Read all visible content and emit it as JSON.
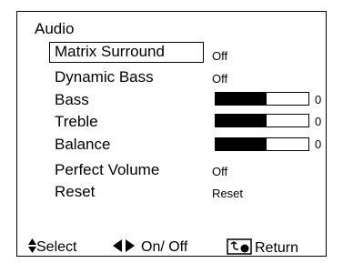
{
  "menu": {
    "title": "Audio",
    "items": [
      {
        "label": "Matrix Surround",
        "value": "Off"
      },
      {
        "label": "Dynamic Bass",
        "value": "Off"
      },
      {
        "label": "Bass",
        "level": 0.55,
        "number": "0"
      },
      {
        "label": "Treble",
        "level": 0.55,
        "number": "0"
      },
      {
        "label": "Balance",
        "level": 0.55,
        "number": "0"
      },
      {
        "label": "Perfect Volume",
        "value": "Off"
      },
      {
        "label": "Reset",
        "value": "Reset"
      }
    ]
  },
  "footer": {
    "select_label": "Select",
    "onoff_label": "On/ Off",
    "return_label": "Return",
    "icons": [
      "up-down-arrows-icon",
      "left-right-arrows-icon",
      "return-icon"
    ]
  }
}
